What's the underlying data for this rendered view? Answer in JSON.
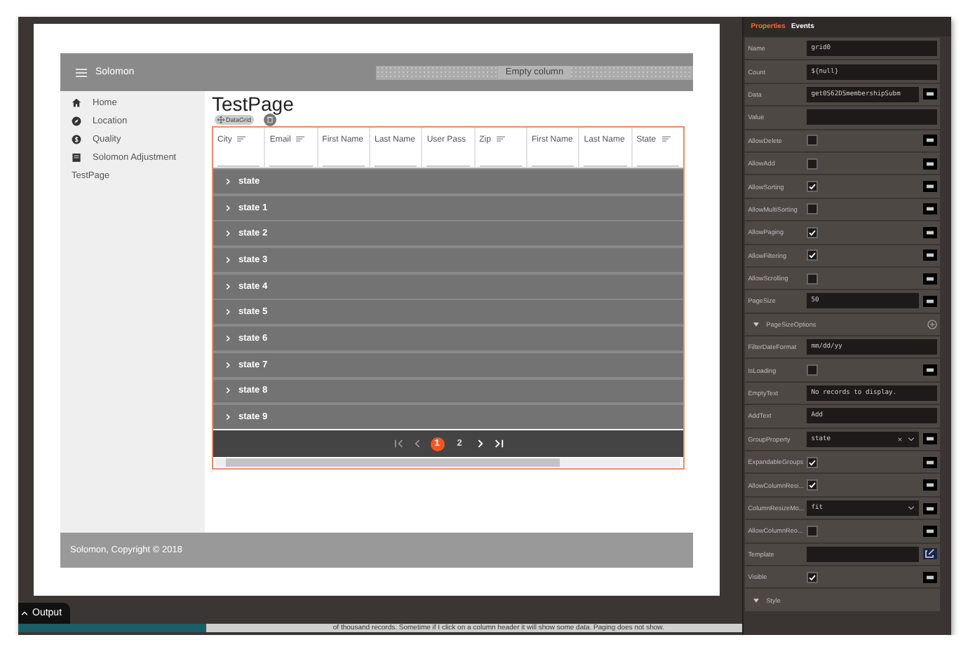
{
  "header": {
    "title": "Solomon",
    "empty_column": "Empty column"
  },
  "sidebar": {
    "items": [
      {
        "label": "Home"
      },
      {
        "label": "Location"
      },
      {
        "label": "Quality"
      },
      {
        "label": "Solomon Adjustment"
      },
      {
        "label": "TestPage"
      }
    ]
  },
  "page_title": "TestPage",
  "designer": {
    "chip": "DataGrid"
  },
  "grid": {
    "columns": [
      {
        "label": "City",
        "sortable": true
      },
      {
        "label": "Email",
        "sortable": true
      },
      {
        "label": "First Name",
        "sortable": false
      },
      {
        "label": "Last Name",
        "sortable": false
      },
      {
        "label": "User Pass",
        "sortable": false
      },
      {
        "label": "Zip",
        "sortable": true
      },
      {
        "label": "First Name",
        "sortable": false
      },
      {
        "label": "Last Name",
        "sortable": false
      },
      {
        "label": "State",
        "sortable": true
      }
    ],
    "groups": [
      {
        "label": "state",
        "expanded": false
      },
      {
        "label": "state 1",
        "expanded": false
      },
      {
        "label": "state 2",
        "expanded": false
      },
      {
        "label": "state 3",
        "expanded": false
      },
      {
        "label": "state 4",
        "expanded": false
      },
      {
        "label": "state 5",
        "expanded": false
      },
      {
        "label": "state 6",
        "expanded": false
      },
      {
        "label": "state 7",
        "expanded": false
      },
      {
        "label": "state 8",
        "expanded": false
      },
      {
        "label": "state 9",
        "expanded": false
      }
    ],
    "pager": {
      "pages": [
        {
          "label": "1",
          "selected": true
        },
        {
          "label": "2",
          "selected": false
        }
      ]
    }
  },
  "footer": "Solomon, Copyright © 2018",
  "properties": {
    "tabs": [
      {
        "label": "Properties",
        "selected": true
      },
      {
        "label": "Events",
        "selected": false
      }
    ],
    "rows": [
      {
        "kind": "text",
        "label": "Name",
        "value": "grid0",
        "bindable": false
      },
      {
        "kind": "text",
        "label": "Count",
        "value": "${null}",
        "bindable": false
      },
      {
        "kind": "text",
        "label": "Data",
        "value": "get0S62DSmembershipSubm",
        "bindable": true
      },
      {
        "kind": "text",
        "label": "Value",
        "bindable": false
      },
      {
        "kind": "check",
        "label": "AllowDelete",
        "checked": false,
        "bindable": true
      },
      {
        "kind": "check",
        "label": "AllowAdd",
        "checked": false,
        "bindable": true
      },
      {
        "kind": "check",
        "label": "AllowSorting",
        "checked": true,
        "bindable": true
      },
      {
        "kind": "check",
        "label": "AllowMultiSorting",
        "checked": false,
        "bindable": true
      },
      {
        "kind": "check",
        "label": "AllowPaging",
        "checked": true,
        "bindable": true
      },
      {
        "kind": "check",
        "label": "AllowFiltering",
        "checked": true,
        "bindable": true
      },
      {
        "kind": "check",
        "label": "AllowScrolling",
        "checked": false,
        "bindable": true
      },
      {
        "kind": "text",
        "label": "PageSize",
        "value": "50",
        "bindable": true
      },
      {
        "kind": "section",
        "label": "PageSizeOptions",
        "expanded": true,
        "add": true
      },
      {
        "kind": "text",
        "label": "FilterDateFormat",
        "value": "mm/dd/yy",
        "bindable": false
      },
      {
        "kind": "check",
        "label": "IsLoading",
        "checked": false,
        "bindable": true
      },
      {
        "kind": "text",
        "label": "EmptyText",
        "value": "No records to display.",
        "bindable": false
      },
      {
        "kind": "text",
        "label": "AddText",
        "value": "Add",
        "bindable": false
      },
      {
        "kind": "select",
        "label": "GroupProperty",
        "value": "state",
        "clearable": true,
        "bindable": true
      },
      {
        "kind": "check",
        "label": "ExpandableGroups",
        "checked": true,
        "bindable": true
      },
      {
        "kind": "check",
        "label": "AllowColumnResi...",
        "checked": true,
        "bindable": true
      },
      {
        "kind": "select",
        "label": "ColumnResizeMo...",
        "value": "fit",
        "clearable": false,
        "bindable": true
      },
      {
        "kind": "check",
        "label": "AllowColumnReo...",
        "checked": false,
        "bindable": true
      },
      {
        "kind": "template",
        "label": "Template"
      },
      {
        "kind": "check",
        "label": "Visible",
        "checked": true,
        "bindable": true
      },
      {
        "kind": "section",
        "label": "Style",
        "expanded": true,
        "add": false
      }
    ]
  },
  "output": {
    "label": "Output"
  },
  "progress": {
    "level": 0.26
  },
  "status_text": "of thousand records. Sometime if I click on a column header it will show some data. Paging does not show."
}
